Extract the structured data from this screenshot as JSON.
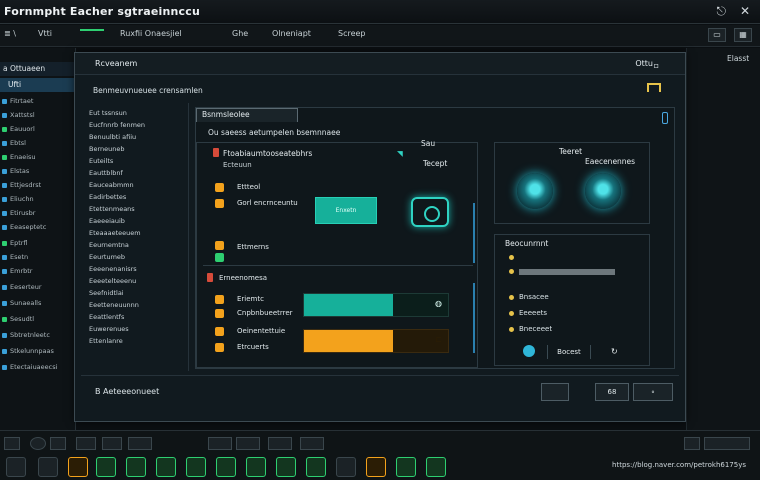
{
  "app": {
    "title": "Fornmpht Eacher sgtraeinnccu"
  },
  "menu": {
    "items": [
      "≣ \\  ",
      "Vtti",
      "Ruxfii Onaesjiel",
      "Ghe",
      "Olneniapt",
      "Screep"
    ]
  },
  "left_panel": {
    "header": "a Ottuaeen",
    "sub": "Ufti",
    "items": [
      "Fitrtaet",
      "Xattstsl",
      "Eauuorl",
      "Ebtsl",
      "Enaeisu",
      "Elstas",
      "Ettjesdrst",
      "Eliuchn",
      "Etirusbr",
      "Eeaseptetc",
      "Eptrfl",
      "Esetn",
      "Emrbtr",
      "Eeserteur",
      "Sunaealls",
      "Sesudtl",
      "Sbtretnleetc",
      "Stkelunnpaas",
      "Etectaiuaeecsi"
    ]
  },
  "right_strip": {
    "label": "Elasst"
  },
  "window": {
    "title": "Rcveanem",
    "right_label": "Ottu",
    "subtitle": "Benmeuvnueuee crensamlen",
    "nav": [
      "Eut tssnsun",
      "Eucfnnrb fenmen",
      "Benuulbti afiiu",
      "Berneuneb",
      "Euteilts",
      "Eauttblbnf",
      "Eauceabmmn",
      "Eadirbettes",
      "Etettenmeans",
      "Eaeeeiauib",
      "Eteaaaeteeuem",
      "Eeurnemtna",
      "Eeurtumeb",
      "Eeeenenanisrs",
      "Eeeetelteeenu",
      "Seefnidtlai",
      "Eeetteneuunnn",
      "Eeattlentfs",
      "Euwerenues",
      "Ettenlanre"
    ]
  },
  "content": {
    "tab": "Bsnmsleolee",
    "path": "Ou saeess aetumpelen bsemnnaee",
    "left_box": {
      "title": "Ftoabiaumtooseatebhrs",
      "subtitle": "Ecteuun",
      "col1": "Sau",
      "col2": "Tecept",
      "row1_label": "Ettteol",
      "row1_sub": "Gorl encrnceuntu",
      "teal_button": "Enxetn",
      "row2_label": "Ettmerns",
      "section2_title": "Erneenomesa",
      "row3_label": "Eriemtc",
      "row3_sub": "Cnpbnbueetrrer",
      "row4_label": "Oeinentettuie",
      "row4_sub": "Etrcuerts"
    },
    "right_box": {
      "head1": "Teeret",
      "head2": "Eaecenennes"
    },
    "right_box2": {
      "title": "Beocunrnnt",
      "item1": "Bnsacee",
      "item2": "Eeeeets",
      "item3": "Bneceeet",
      "button": "Bocest"
    }
  },
  "bottom": {
    "label": "B Aeteeeonueet",
    "btn1": "",
    "btn2": "68",
    "btn3": "∘"
  },
  "progress": {
    "teal_value": 0.62,
    "orange_value": 0.62
  },
  "taskbar": {
    "watermark": "https://blog.naver.com/petrokh6175ys"
  },
  "colors": {
    "accent_green": "#2ecf71",
    "accent_teal": "#16b09a",
    "accent_orange": "#f3a21c",
    "panel_bg": "#111a1f"
  }
}
